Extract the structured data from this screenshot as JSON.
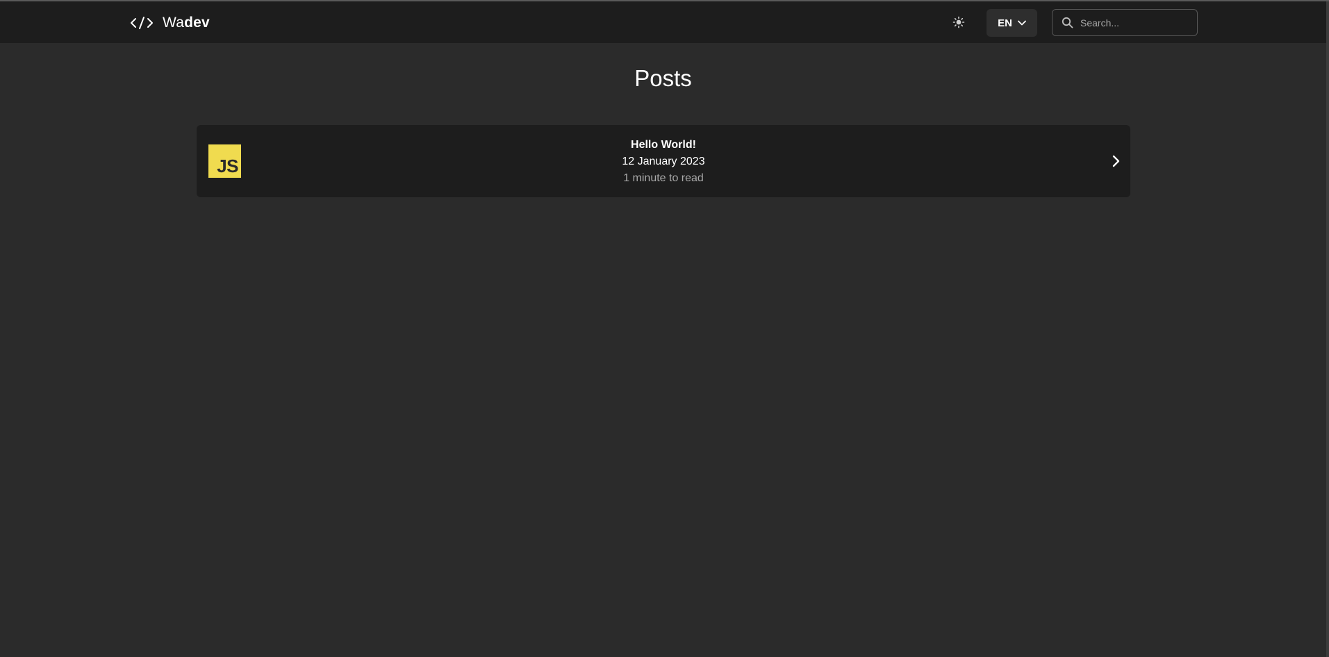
{
  "navbar": {
    "brand_prefix": "Wa",
    "brand_suffix": "dev",
    "code_icon": "code-brackets-icon",
    "theme_icon": "sun-icon",
    "language": {
      "selected": "EN",
      "icon": "chevron-down-icon"
    },
    "search": {
      "placeholder": "Search...",
      "value": "",
      "icon": "search-icon"
    }
  },
  "main": {
    "title": "Posts",
    "posts": [
      {
        "thumbnail_text": "JS",
        "thumbnail_color": "#f0db4f",
        "title": "Hello World!",
        "date": "12 January 2023",
        "read_time": "1 minute to read",
        "chevron_icon": "chevron-right-icon"
      }
    ]
  },
  "colors": {
    "background": "#2b2b2b",
    "surface": "#1d1d1d",
    "text": "#ffffff",
    "muted_text": "#a9a9a9",
    "js_yellow": "#f0db4f"
  }
}
